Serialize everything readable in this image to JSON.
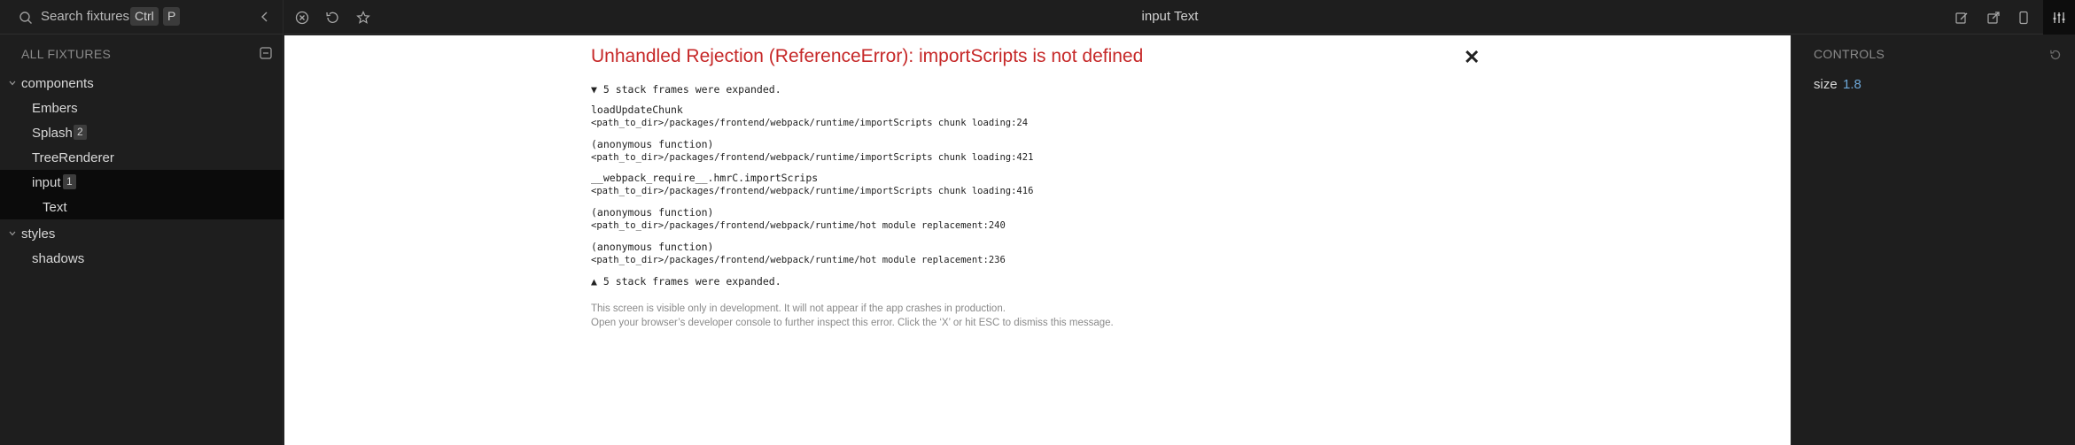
{
  "search": {
    "placeholder": "Search fixtures",
    "shortcut_ctrl": "Ctrl",
    "shortcut_key": "P"
  },
  "sidebar": {
    "header": "ALL FIXTURES",
    "tree": [
      {
        "label": "components",
        "type": "group",
        "expanded": true
      },
      {
        "label": "Embers",
        "type": "fixture"
      },
      {
        "label": "Splash",
        "type": "fixture",
        "badge": "2"
      },
      {
        "label": "TreeRenderer",
        "type": "fixture"
      },
      {
        "label": "input",
        "type": "fixture",
        "badge": "1",
        "selected": true
      },
      {
        "label": "Text",
        "type": "child",
        "selected": true
      },
      {
        "label": "styles",
        "type": "group",
        "expanded": true
      },
      {
        "label": "shadows",
        "type": "fixture"
      }
    ]
  },
  "toolbar": {
    "title": "input Text",
    "left_icons": [
      "close-circle-icon",
      "reload-icon",
      "star-icon"
    ],
    "right_icons": [
      "edit-icon",
      "open-external-icon",
      "device-icon",
      "controls-sliders-icon"
    ]
  },
  "error": {
    "title": "Unhandled Rejection (ReferenceError): importScripts is not defined",
    "close": "✕",
    "frames_top": "▼ 5 stack frames were expanded.",
    "frames": [
      {
        "fn": "loadUpdateChunk",
        "path": "<path_to_dir>/packages/frontend/webpack/runtime/importScripts chunk loading:24"
      },
      {
        "fn": "(anonymous function)",
        "path": "<path_to_dir>/packages/frontend/webpack/runtime/importScripts chunk loading:421"
      },
      {
        "fn": "__webpack_require__.hmrC.importScrips",
        "path": "<path_to_dir>/packages/frontend/webpack/runtime/importScripts chunk loading:416"
      },
      {
        "fn": "(anonymous function)",
        "path": "<path_to_dir>/packages/frontend/webpack/runtime/hot module replacement:240"
      },
      {
        "fn": "(anonymous function)",
        "path": "<path_to_dir>/packages/frontend/webpack/runtime/hot module replacement:236"
      }
    ],
    "frames_bottom": "▲ 5 stack frames were expanded.",
    "note_line1": "This screen is visible only in development. It will not appear if the app crashes in production.",
    "note_line2": "Open your browser’s developer console to further inspect this error.  Click the ‘X’ or hit ESC to dismiss this message."
  },
  "controls": {
    "header": "CONTROLS",
    "items": [
      {
        "key": "size",
        "value": "1.8"
      }
    ]
  },
  "colors": {
    "background": "#1e1e1e",
    "selected_row": "#0b0b0b",
    "error_title": "#c62828",
    "control_value": "#6ea8d9"
  }
}
